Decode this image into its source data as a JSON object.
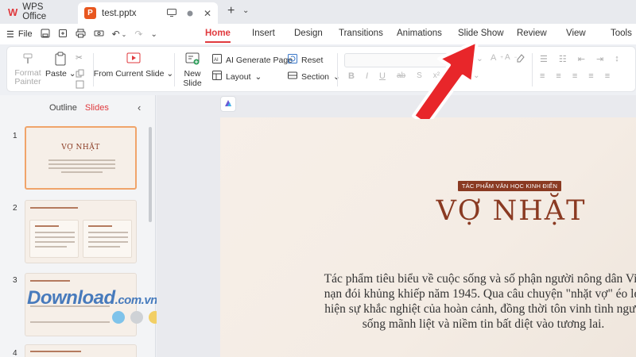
{
  "titlebar": {
    "app_name": "WPS Office",
    "file_name": "test.pptx"
  },
  "menubar": {
    "file_label": "File",
    "tabs": [
      "Home",
      "Insert",
      "Design",
      "Transitions",
      "Animations",
      "Slide Show",
      "Review",
      "View",
      "Tools"
    ],
    "active_tab": "Home"
  },
  "ribbon": {
    "format_painter": "Format Painter",
    "paste": "Paste",
    "from_current_slide": "From Current Slide",
    "new_slide": "New Slide",
    "ai_generate_page": "AI Generate Page",
    "layout": "Layout",
    "reset": "Reset",
    "section": "Section"
  },
  "panel": {
    "outline_tab": "Outline",
    "slides_tab": "Slides",
    "slide_numbers": [
      "1",
      "2",
      "3",
      "4"
    ],
    "thumb1_title": "VỢ NHẶT"
  },
  "watermark": {
    "text": "Download",
    "suffix": ".com.vn",
    "dot_colors": [
      "#7fc3ea",
      "#cfd2d6",
      "#f2cf65",
      "#8cc86a",
      "#4a90d9",
      "#f07b7b"
    ]
  },
  "slide": {
    "badge": "TÁC PHẨM VĂN HỌC KINH ĐIỂN",
    "title": "VỢ NHẶT",
    "body_lines": [
      "Tác phẩm tiêu biểu về cuộc sống và số phận người nông dân Việ",
      "nạn đói khủng khiếp năm 1945. Qua câu chuyện \"nhặt vợ\" éo le,",
      "hiện sự khắc nghiệt của hoàn cảnh, đồng thời tôn vinh tình ngườ",
      "sống mãnh liệt và niềm tin bất diệt vào tương lai."
    ]
  },
  "colors": {
    "accent": "#e03a3e",
    "slide_title": "#8a3a22",
    "arrow": "#e8262a"
  }
}
